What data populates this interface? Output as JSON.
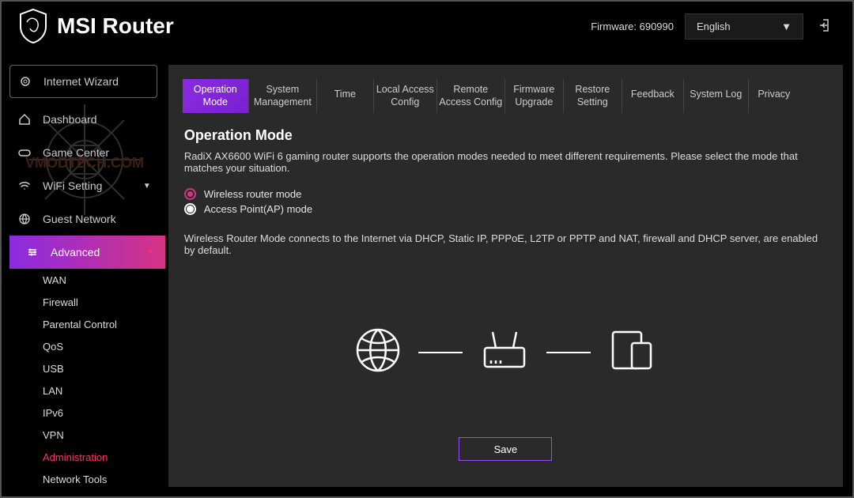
{
  "header": {
    "brand": "MSI Router",
    "firmware_label": "Firmware: 690990",
    "language": "English"
  },
  "sidebar": {
    "wizard": "Internet Wizard",
    "items": [
      {
        "label": "Dashboard"
      },
      {
        "label": "Game Center"
      },
      {
        "label": "WiFi Setting"
      },
      {
        "label": "Guest Network"
      },
      {
        "label": "Advanced"
      }
    ],
    "advanced_sub": [
      "WAN",
      "Firewall",
      "Parental Control",
      "QoS",
      "USB",
      "LAN",
      "IPv6",
      "VPN",
      "Administration",
      "Network Tools"
    ]
  },
  "tabs": [
    "Operation Mode",
    "System Management",
    "Time",
    "Local Access Config",
    "Remote Access Config",
    "Firmware Upgrade",
    "Restore Setting",
    "Feedback",
    "System Log",
    "Privacy"
  ],
  "page": {
    "title": "Operation Mode",
    "description": "RadiX AX6600 WiFi 6 gaming router supports the operation modes needed to meet different requirements. Please select the mode that matches your situation.",
    "option1": "Wireless router mode",
    "option2": "Access Point(AP) mode",
    "mode_desc": "Wireless Router Mode connects to the Internet via DHCP, Static IP, PPPoE, L2TP or PPTP and NAT, firewall and DHCP server, are enabled by default.",
    "save_label": "Save"
  },
  "watermark": "VMODTECH.COM"
}
